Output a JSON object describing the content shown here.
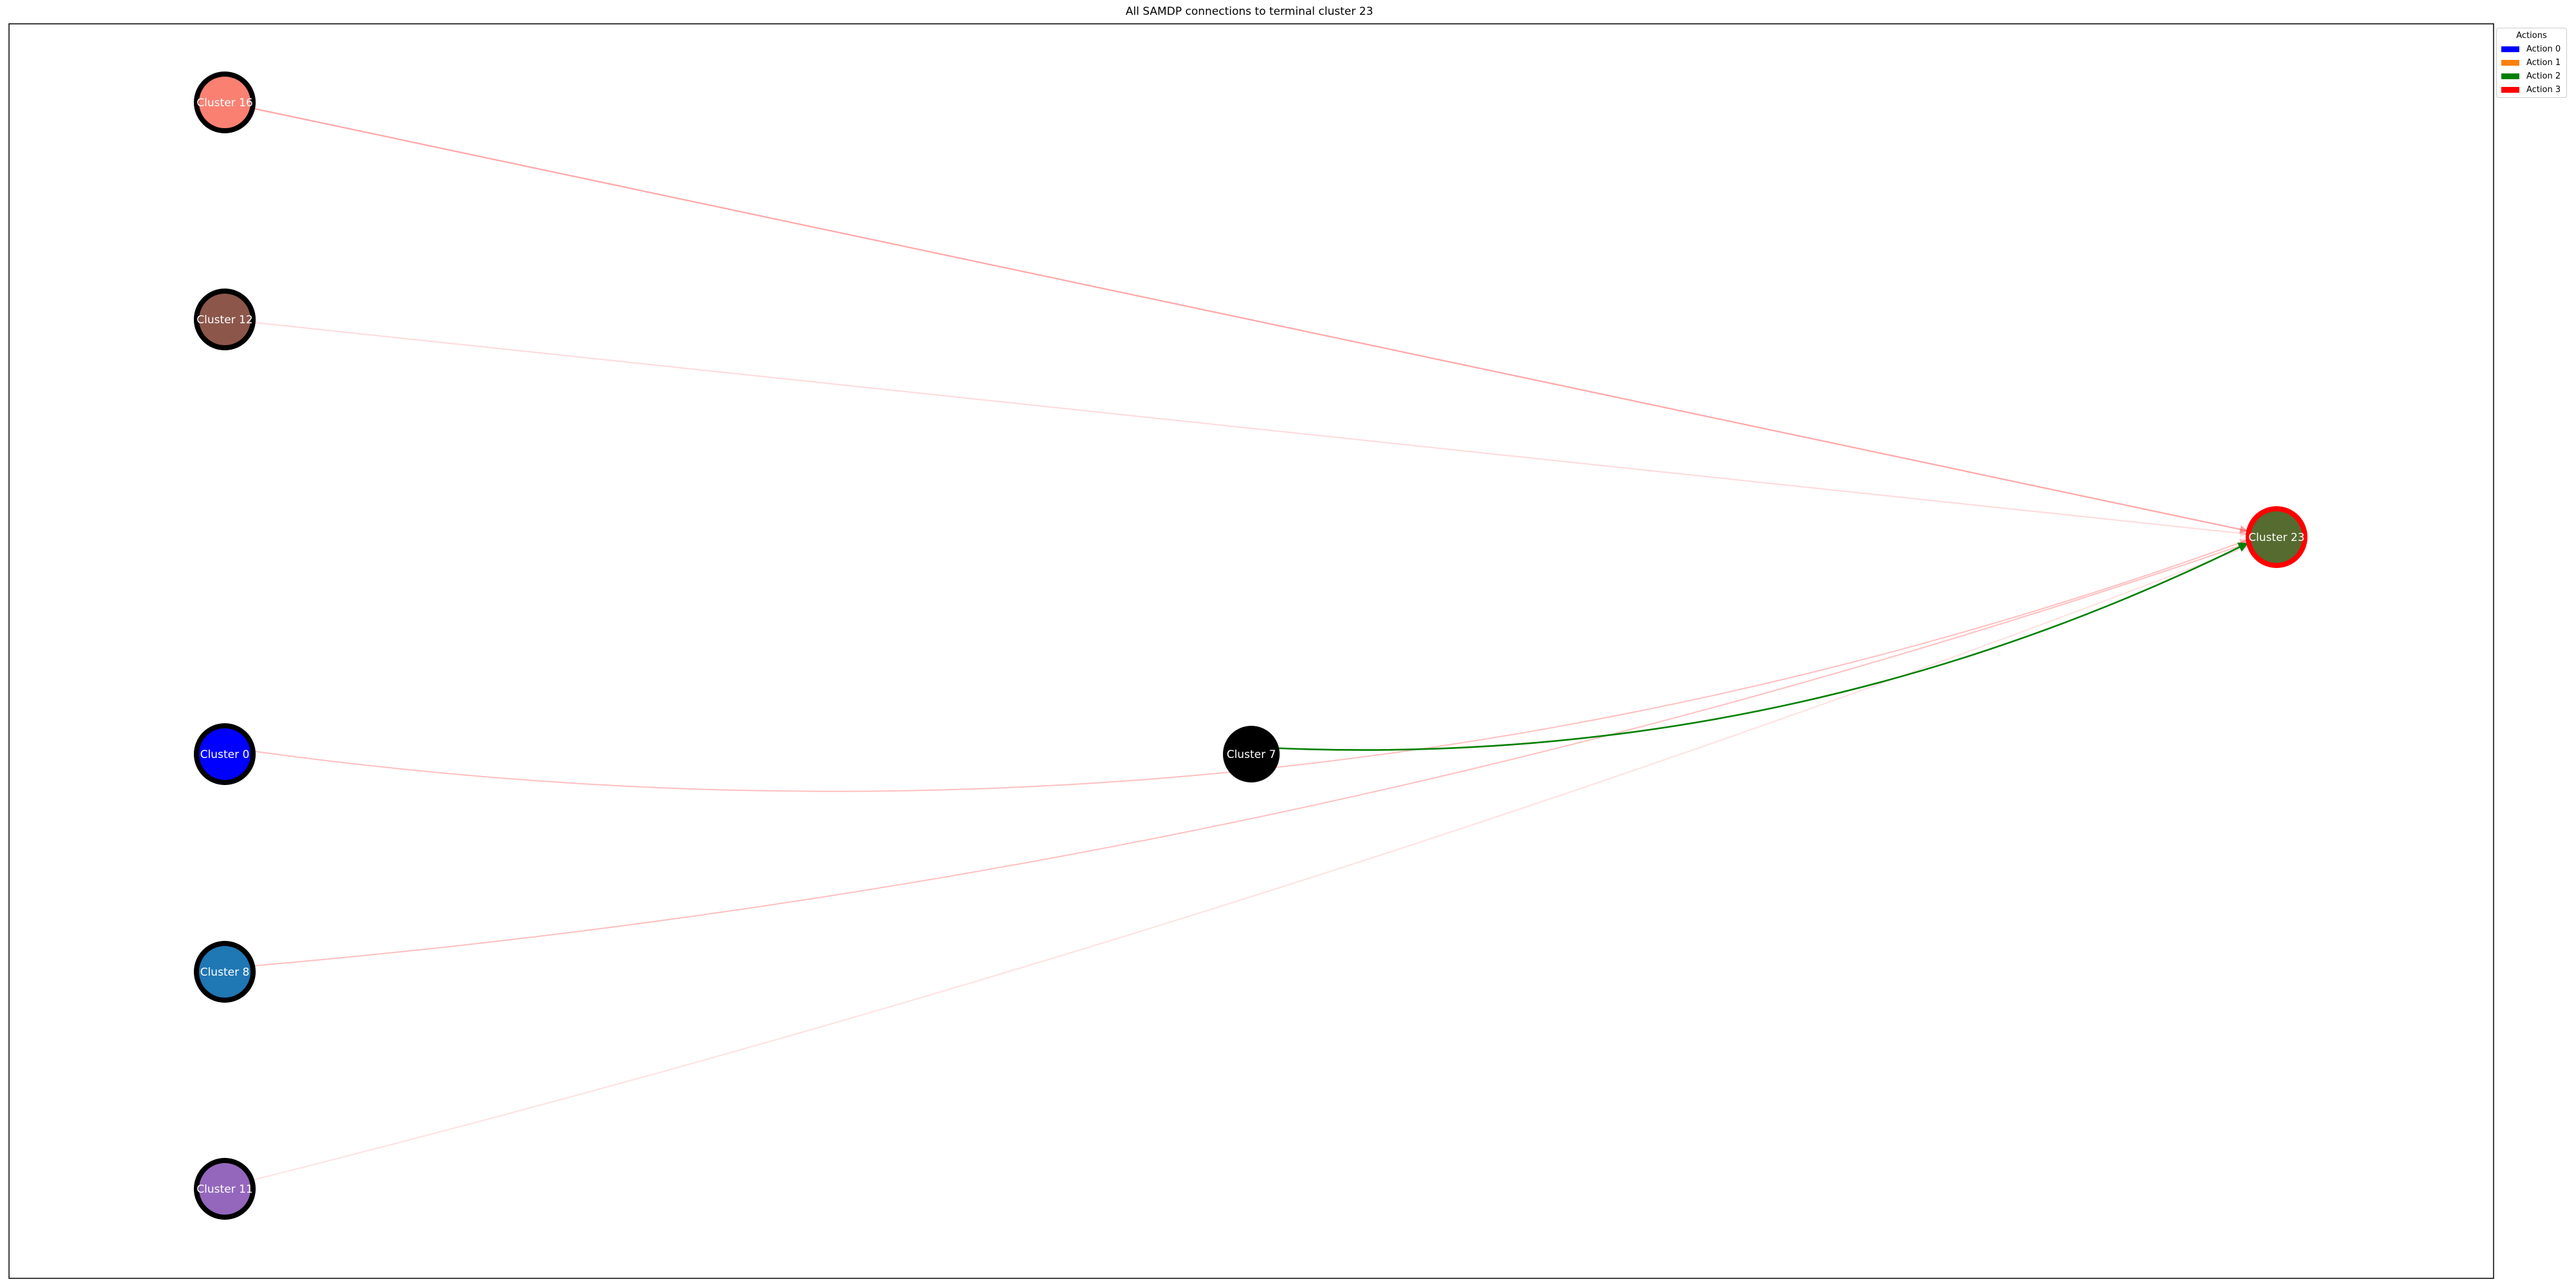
{
  "title": "All SAMDP connections to terminal cluster 23",
  "nodes": [
    {
      "id": "c16",
      "label": "Cluster 16",
      "fill": "#fa8072",
      "stroke": "#000000"
    },
    {
      "id": "c12",
      "label": "Cluster 12",
      "fill": "#8c564b",
      "stroke": "#000000"
    },
    {
      "id": "c0",
      "label": "Cluster 0",
      "fill": "#0000ff",
      "stroke": "#000000"
    },
    {
      "id": "c8",
      "label": "Cluster 8",
      "fill": "#1f77b4",
      "stroke": "#000000"
    },
    {
      "id": "c11",
      "label": "Cluster 11",
      "fill": "#9467bd",
      "stroke": "#000000"
    },
    {
      "id": "c7",
      "label": "Cluster 7",
      "fill": "#000000",
      "stroke": "#000000"
    },
    {
      "id": "c23",
      "label": "Cluster 23",
      "fill": "#556b2f",
      "stroke": "#ff0000"
    }
  ],
  "edges": [
    {
      "from": "c16",
      "to": "c23",
      "color": "#ff0000",
      "action": "Action 3"
    },
    {
      "from": "c12",
      "to": "c23",
      "color": "#ff0000",
      "action": "Action 3"
    },
    {
      "from": "c0",
      "to": "c23",
      "color": "#ff0000",
      "action": "Action 3"
    },
    {
      "from": "c8",
      "to": "c23",
      "color": "#ff0000",
      "action": "Action 3"
    },
    {
      "from": "c11",
      "to": "c23",
      "color": "#ff0000",
      "action": "Action 3"
    },
    {
      "from": "c7",
      "to": "c23",
      "color": "#008000",
      "action": "Action 2"
    }
  ],
  "legend": {
    "title": "Actions",
    "items": [
      {
        "label": "Action 0",
        "color": "#0000ff"
      },
      {
        "label": "Action 1",
        "color": "#ff7f0e"
      },
      {
        "label": "Action 2",
        "color": "#008000"
      },
      {
        "label": "Action 3",
        "color": "#ff0000"
      }
    ]
  }
}
